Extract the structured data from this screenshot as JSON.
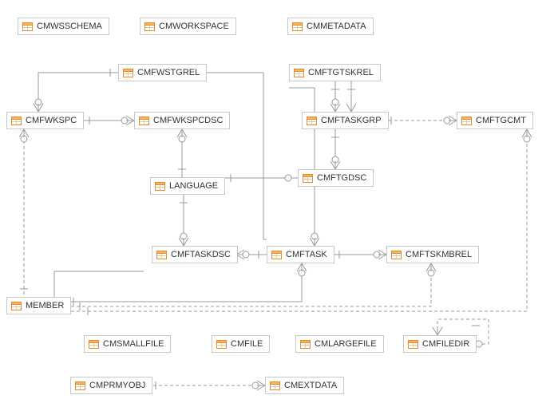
{
  "entities": [
    {
      "id": "n1",
      "label": "CMWSSCHEMA"
    },
    {
      "id": "n2",
      "label": "CMWORKSPACE"
    },
    {
      "id": "n3",
      "label": "CMMETADATA"
    },
    {
      "id": "n4",
      "label": "CMFWSTGREL"
    },
    {
      "id": "n5",
      "label": "CMFTGTSKREL"
    },
    {
      "id": "n6",
      "label": "CMFWKSPC"
    },
    {
      "id": "n7",
      "label": "CMFWKSPCDSC"
    },
    {
      "id": "n8",
      "label": "CMFTASKGRP"
    },
    {
      "id": "n9",
      "label": "CMFTGCMT"
    },
    {
      "id": "n10",
      "label": "LANGUAGE"
    },
    {
      "id": "n11",
      "label": "CMFTGDSC"
    },
    {
      "id": "n12",
      "label": "CMFTASKDSC"
    },
    {
      "id": "n13",
      "label": "CMFTASK"
    },
    {
      "id": "n14",
      "label": "CMFTSKMBREL"
    },
    {
      "id": "n15",
      "label": "MEMBER"
    },
    {
      "id": "n16",
      "label": "CMSMALLFILE"
    },
    {
      "id": "n17",
      "label": "CMFILE"
    },
    {
      "id": "n18",
      "label": "CMLARGEFILE"
    },
    {
      "id": "n19",
      "label": "CMFILEDIR"
    },
    {
      "id": "n20",
      "label": "CMPRMYOBJ"
    },
    {
      "id": "n21",
      "label": "CMEXTDATA"
    }
  ],
  "relations": [
    {
      "from": "CMFWSTGREL",
      "to": "CMFWKSPC",
      "style": "solid"
    },
    {
      "from": "CMFWKSPC",
      "to": "CMFWKSPCDSC",
      "style": "solid"
    },
    {
      "from": "CMFWKSPCDSC",
      "to": "LANGUAGE",
      "style": "solid"
    },
    {
      "from": "CMFTGTSKREL",
      "to": "CMFTASKGRP",
      "style": "solid"
    },
    {
      "from": "CMFTASKGRP",
      "to": "CMFTGCMT",
      "style": "dashed"
    },
    {
      "from": "CMFTASKGRP",
      "to": "CMFTGDSC",
      "style": "solid"
    },
    {
      "from": "CMFTGDSC",
      "to": "LANGUAGE",
      "style": "solid"
    },
    {
      "from": "LANGUAGE",
      "to": "CMFTASKDSC",
      "style": "solid"
    },
    {
      "from": "CMFTASKDSC",
      "to": "CMFTASK",
      "style": "solid"
    },
    {
      "from": "CMFTASK",
      "to": "CMFTSKMBREL",
      "style": "solid"
    },
    {
      "from": "CMFTASK",
      "to": "CMFTGTSKREL",
      "style": "solid"
    },
    {
      "from": "CMFWSTGREL",
      "to": "CMFTASKGRP",
      "style": "solid"
    },
    {
      "from": "CMFWKSPC",
      "to": "MEMBER",
      "style": "dashed"
    },
    {
      "from": "MEMBER",
      "to": "CMFTASK",
      "style": "solid"
    },
    {
      "from": "MEMBER",
      "to": "CMFTSKMBREL",
      "style": "dashed"
    },
    {
      "from": "MEMBER",
      "to": "CMFTGCMT",
      "style": "dashed"
    },
    {
      "from": "CMFILEDIR",
      "to": "CMFILEDIR",
      "style": "dashed"
    },
    {
      "from": "CMPRMYOBJ",
      "to": "CMEXTDATA",
      "style": "dashed"
    }
  ],
  "colors": {
    "border": "#c8c8c8",
    "connector": "#999999",
    "icon_fill": "#f3b65f",
    "icon_stroke": "#e08b2c"
  }
}
